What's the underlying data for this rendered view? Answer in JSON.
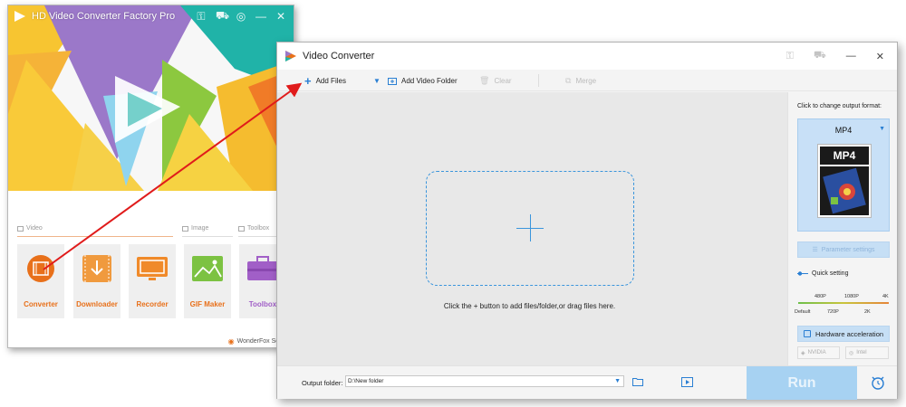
{
  "background_window": {
    "title": "HD Video Converter Factory Pro",
    "sections": {
      "video": "Video",
      "image": "Image",
      "toolbox": "Toolbox"
    },
    "tiles": [
      {
        "label": "Converter",
        "icon": "film-icon",
        "color": "#e8701a"
      },
      {
        "label": "Downloader",
        "icon": "download-icon",
        "color": "#f09a3e"
      },
      {
        "label": "Recorder",
        "icon": "monitor-icon",
        "color": "#f08a2a"
      },
      {
        "label": "GIF Maker",
        "icon": "picture-icon",
        "color": "#7cc242"
      },
      {
        "label": "Toolbox",
        "icon": "toolbox-icon",
        "color": "#a15fc7"
      }
    ],
    "footer": "WonderFox Soft,"
  },
  "window": {
    "title": "Video Converter",
    "controls": {
      "minimize": "—",
      "close": "✕"
    }
  },
  "toolbar": {
    "add_files": "Add Files",
    "add_video_folder": "Add Video Folder",
    "clear": "Clear",
    "merge": "Merge"
  },
  "drop_area": {
    "hint": "Click the + button to add files/folder,or drag files here."
  },
  "output_format": {
    "caption": "Click to change output format:",
    "selected": "MP4",
    "thumb_label": "MP4"
  },
  "parameter_settings": "Parameter settings",
  "quick_setting": {
    "label": "Quick setting",
    "top_labels": [
      "480P",
      "1080P",
      "4K"
    ],
    "bottom_labels": [
      "Default",
      "720P",
      "2K"
    ]
  },
  "hardware_acceleration": "Hardware acceleration",
  "gpu": {
    "nvidia": "NVIDIA",
    "intel": "Intel"
  },
  "bottom": {
    "output_folder_label": "Output folder:",
    "output_folder_value": "D:\\New folder",
    "run": "Run"
  },
  "colors": {
    "accent_blue": "#2a7fd3",
    "run_button": "#a7d2f2",
    "arrow": "#e01b1b",
    "dash_border": "#3a95dc"
  }
}
